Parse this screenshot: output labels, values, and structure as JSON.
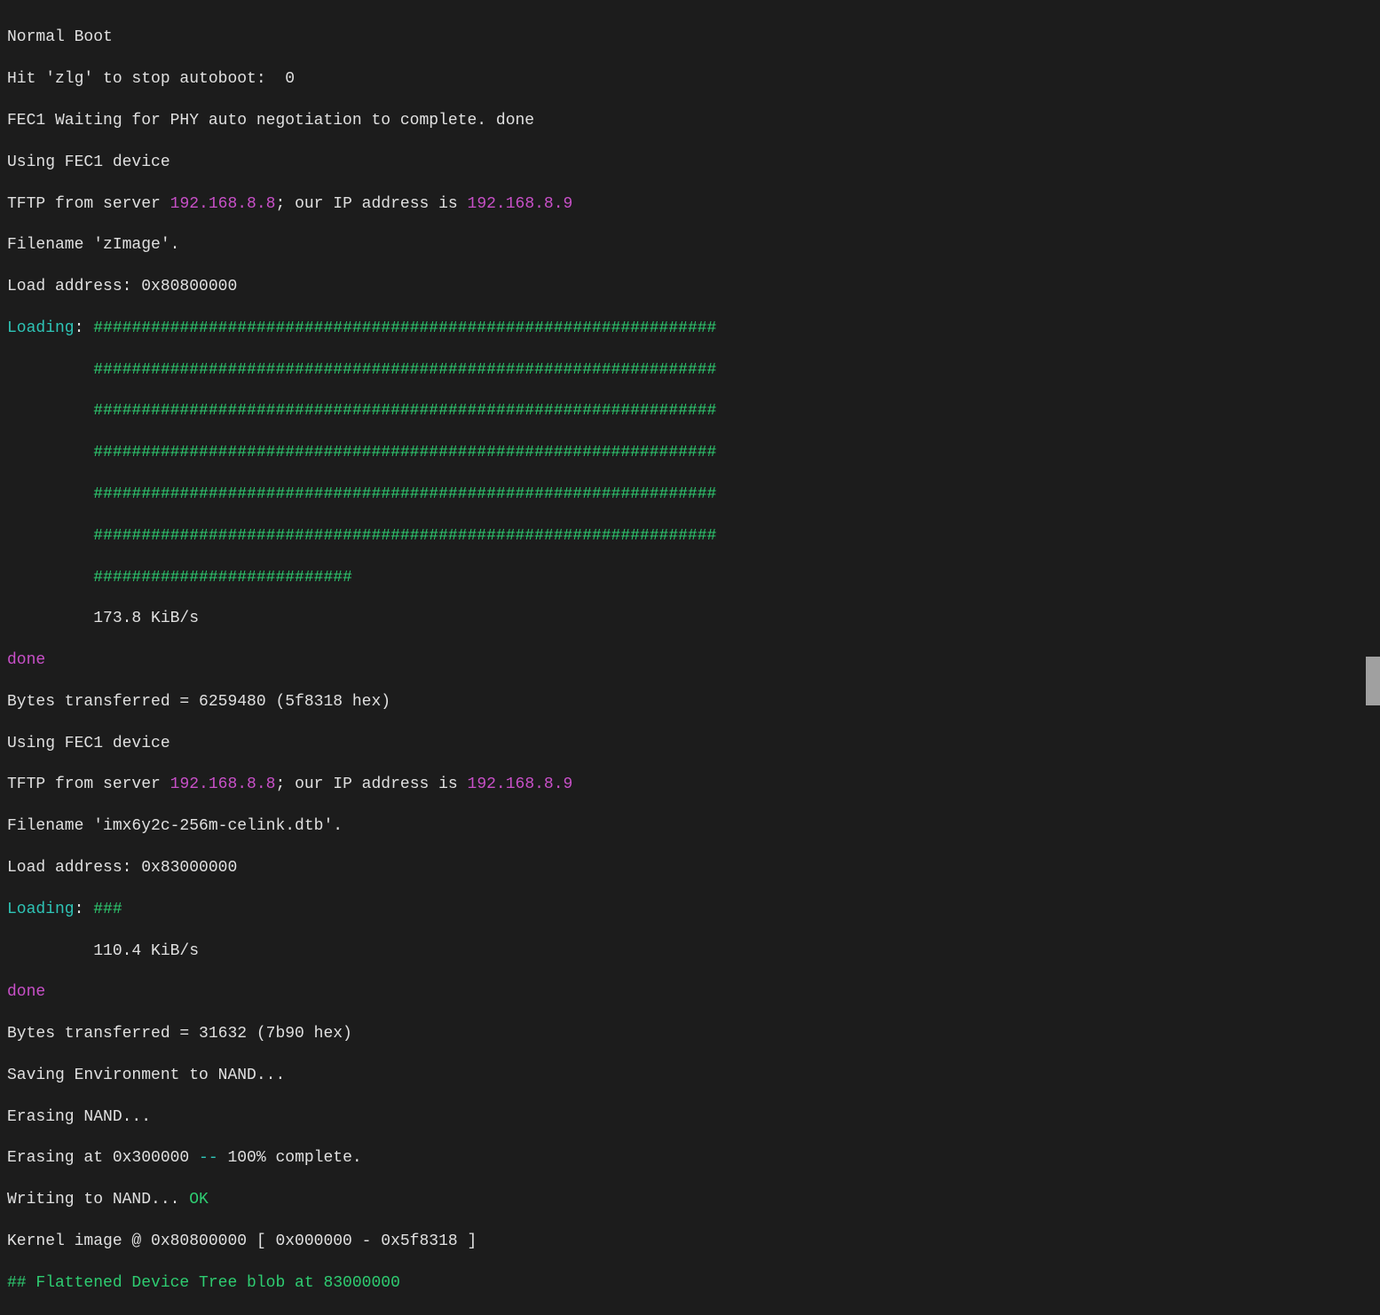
{
  "colors": {
    "bg": "#1c1c1c",
    "text": "#e0e0e0",
    "cyan": "#2ec4b6",
    "green": "#2ecc71",
    "magenta": "#c850c8"
  },
  "lines": {
    "l01": "Normal Boot",
    "l02": "Hit 'zlg' to stop autoboot:  0",
    "l03": "FEC1 Waiting for PHY auto negotiation to complete. done",
    "l04": "Using FEC1 device",
    "l05a": "TFTP from server ",
    "l05b": "192.168.8.8",
    "l05c": "; our IP address is ",
    "l05d": "192.168.8.9",
    "l06": "Filename 'zImage'.",
    "l07": "Load address: 0x80800000",
    "l08a": "Loading",
    "l08b": ": ",
    "l08c": "#################################################################",
    "l09": "         #################################################################",
    "l10": "         #################################################################",
    "l11": "         #################################################################",
    "l12": "         #################################################################",
    "l13": "         #################################################################",
    "l14": "         ###########################",
    "l15": "         173.8 KiB/s",
    "l16": "done",
    "l17": "Bytes transferred = 6259480 (5f8318 hex)",
    "l18": "Using FEC1 device",
    "l19a": "TFTP from server ",
    "l19b": "192.168.8.8",
    "l19c": "; our IP address is ",
    "l19d": "192.168.8.9",
    "l20": "Filename 'imx6y2c-256m-celink.dtb'.",
    "l21": "Load address: 0x83000000",
    "l22a": "Loading",
    "l22b": ": ",
    "l22c": "###",
    "l23": "         110.4 KiB/s",
    "l24": "done",
    "l25": "Bytes transferred = 31632 (7b90 hex)",
    "l26": "Saving Environment to NAND...",
    "l27": "Erasing NAND...",
    "l28a": "Erasing at 0x300000 ",
    "l28b": "--",
    "l28c": " 100% complete.",
    "l29a": "Writing to NAND... ",
    "l29b": "OK",
    "l30": "Kernel image @ 0x80800000 [ 0x000000 - 0x5f8318 ]",
    "l31": "## Flattened Device Tree blob at 83000000"
  }
}
